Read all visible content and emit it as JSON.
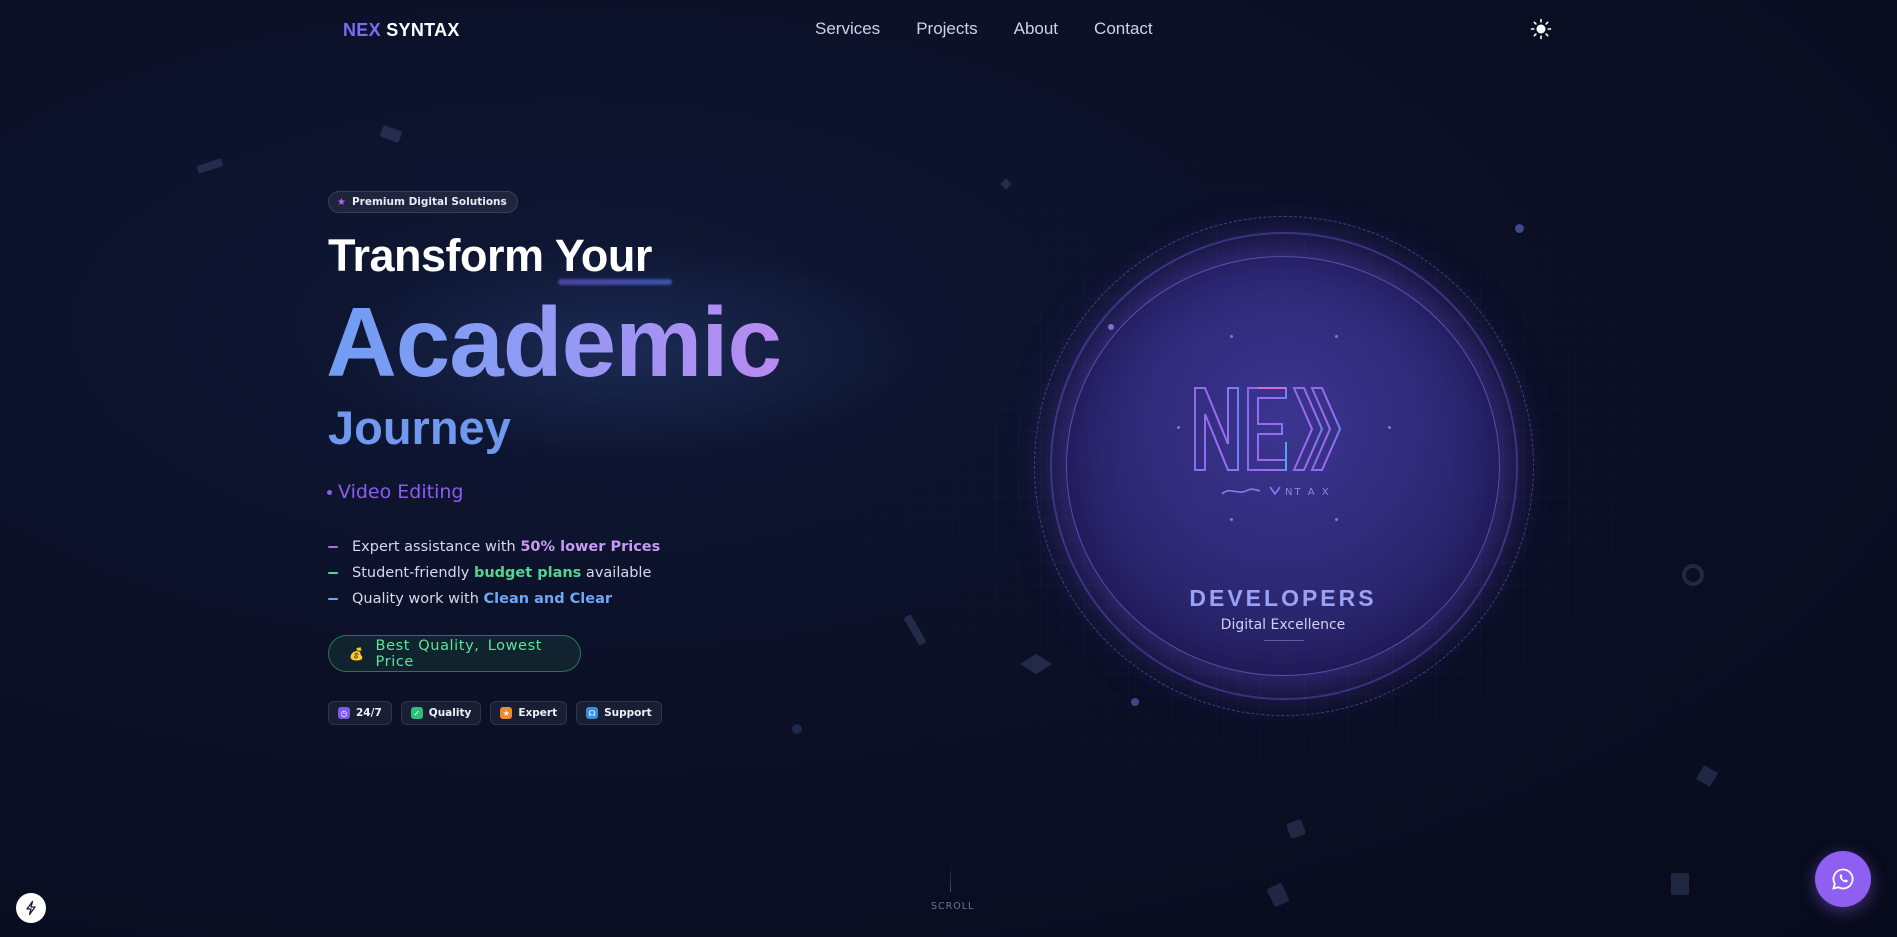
{
  "nav": {
    "logo_part1": "NEX",
    "logo_part2": "SYNTAX",
    "links": [
      {
        "label": "Services"
      },
      {
        "label": "Projects"
      },
      {
        "label": "About"
      },
      {
        "label": "Contact"
      }
    ],
    "theme_icon": "sun-icon"
  },
  "hero": {
    "badge": "Premium Digital Solutions",
    "title_line1": "Transform Your",
    "title_line2": "Academic",
    "title_line3": "Journey",
    "rotating_text": "Video Editing",
    "features": [
      {
        "prefix": "Expert assistance with ",
        "highlight": "50% lower Prices",
        "suffix": "",
        "dash_color": "#a86cf0"
      },
      {
        "prefix": "Student-friendly ",
        "highlight": "budget plans",
        "suffix": " available",
        "dash_color": "#4fd88a"
      },
      {
        "prefix": "Quality work with ",
        "highlight": "Clean and Clear",
        "suffix": "",
        "dash_color": "#6ea8f5"
      }
    ],
    "cta_label": "Best Quality, Lowest Price",
    "cta_icon": "money-bag-icon",
    "chips": [
      {
        "label": "24/7",
        "icon": "clock-icon",
        "color": "#7a5cf0"
      },
      {
        "label": "Quality",
        "icon": "check-icon",
        "color": "#2fbf7a"
      },
      {
        "label": "Expert",
        "icon": "star-icon",
        "color": "#f08a2f"
      },
      {
        "label": "Support",
        "icon": "headset-icon",
        "color": "#3b8fe0"
      }
    ]
  },
  "showcase": {
    "logo_text": "NEX",
    "logo_subtext": "NT A X",
    "title": "DEVELOPERS",
    "subtitle": "Digital Excellence"
  },
  "footer": {
    "scroll_label": "SCROLL",
    "chat_icon": "whatsapp-icon",
    "corner_icon": "lightning-icon"
  },
  "colors": {
    "background": "#0b1026",
    "accent_purple": "#8e5ff0",
    "accent_blue": "#6f98ee",
    "accent_green": "#4fd88a"
  }
}
